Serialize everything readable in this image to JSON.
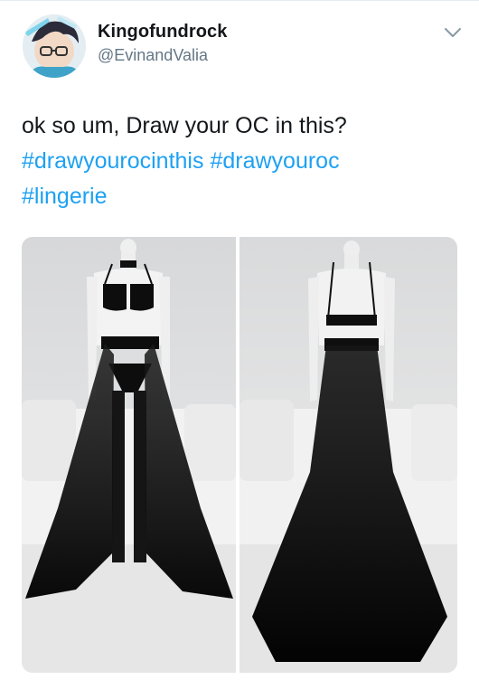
{
  "tweet": {
    "author": {
      "display_name": "Kingofundrock",
      "handle": "@EvinandValia"
    },
    "text": {
      "line1": "ok so um, Draw your OC in this?",
      "hashtags": [
        "#drawyourocinthis",
        "#drawyouroc",
        "#lingerie"
      ]
    },
    "menu_icon": "chevron-down-icon",
    "media": [
      {
        "name": "lingerie-front-photo"
      },
      {
        "name": "lingerie-back-photo"
      }
    ]
  },
  "colors": {
    "hashtag": "#1da1f2",
    "text": "#14171a",
    "muted": "#657786"
  }
}
